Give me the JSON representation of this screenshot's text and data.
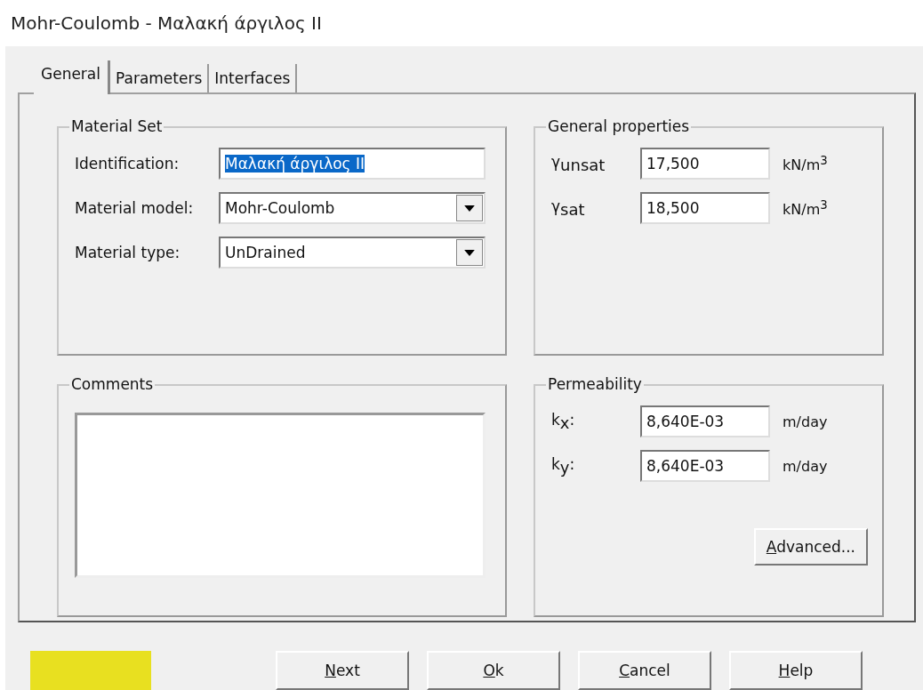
{
  "window": {
    "title": "Mohr-Coulomb - Μαλακή άργιλος ΙΙ"
  },
  "tabs": [
    {
      "label": "General",
      "selected": true
    },
    {
      "label": "Parameters",
      "selected": false
    },
    {
      "label": "Interfaces",
      "selected": false
    }
  ],
  "material_set": {
    "title": "Material Set",
    "identification": {
      "label": "Identification:",
      "value": "Μαλακή άργιλος ΙΙ",
      "selected": true
    },
    "material_model": {
      "label": "Material model:",
      "value": "Mohr-Coulomb"
    },
    "material_type": {
      "label": "Material type:",
      "value": "UnDrained"
    }
  },
  "general_properties": {
    "title": "General properties",
    "rows": [
      {
        "label": "γ$_{unsat}$",
        "value": "17,500",
        "unit": "kN/m$^{3}$"
      },
      {
        "label": "γ$_{sat}$",
        "value": "18,500",
        "unit": "kN/m$^{3}$"
      }
    ]
  },
  "comments": {
    "title": "Comments"
  },
  "permeability": {
    "title": "Permeability",
    "rows": [
      {
        "label": "k$_{x}$:",
        "value": "8,640E-03",
        "unit": "m/day"
      },
      {
        "label": "k$_{y}$:",
        "value": "8,640E-03",
        "unit": "m/day"
      }
    ],
    "advanced_button": {
      "mnemonic": "A",
      "rest": "dvanced..."
    }
  },
  "color_swatch": {
    "color": "#e8e020"
  },
  "buttons": [
    {
      "mnemonic": "N",
      "rest": "ext"
    },
    {
      "mnemonic": "O",
      "rest": "k"
    },
    {
      "mnemonic": "C",
      "rest": "ancel"
    },
    {
      "mnemonic": "H",
      "rest": "elp"
    }
  ]
}
